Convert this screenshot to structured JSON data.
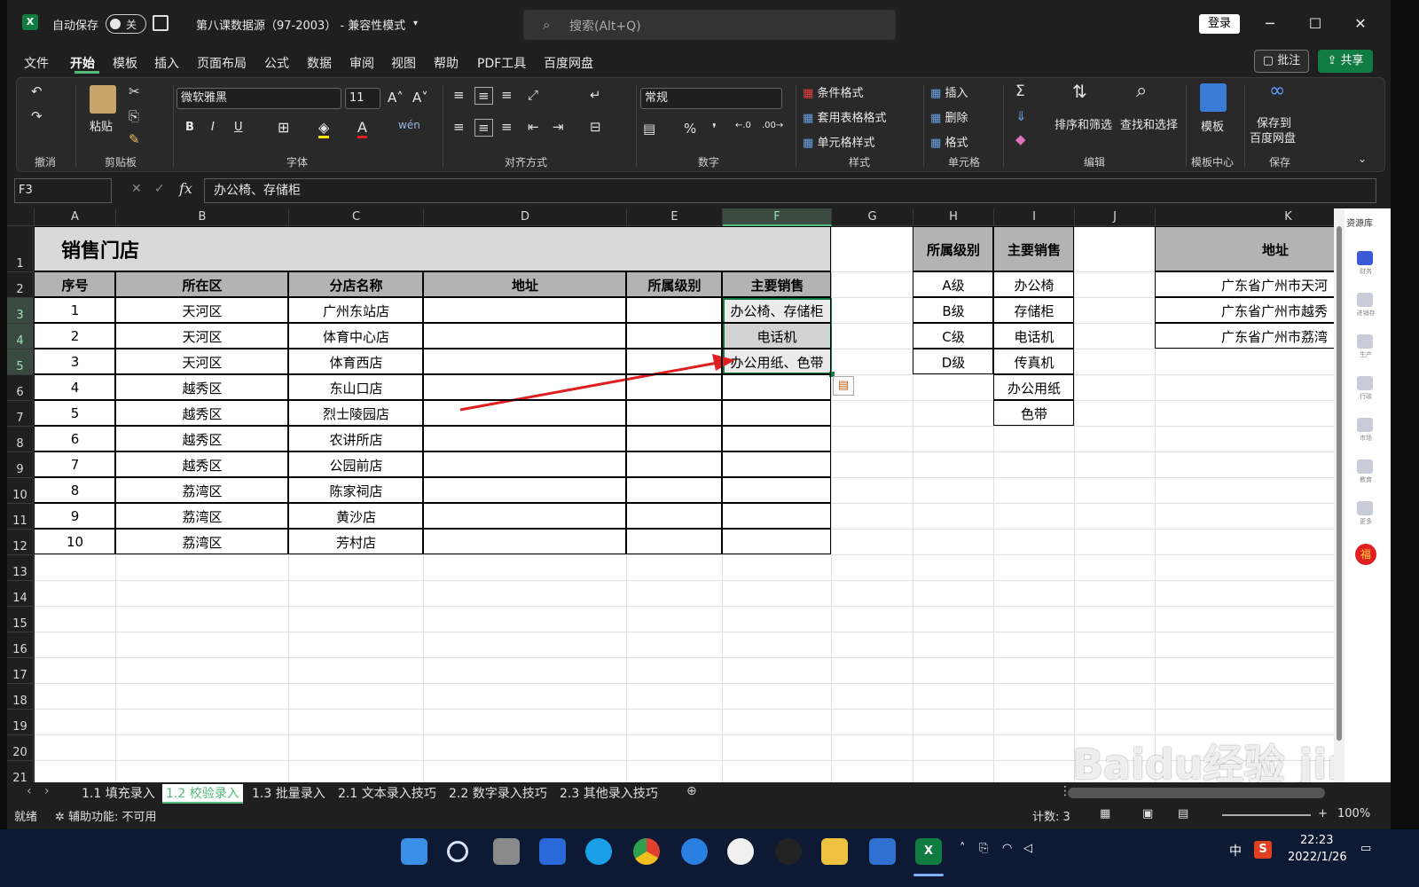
{
  "title_bar": {
    "app_icon": "X",
    "autosave_label": "自动保存",
    "autosave_state": "关",
    "document_title": "第八课数据源（97-2003） - 兼容性模式",
    "search_placeholder": "搜索(Alt+Q)",
    "login_label": "登录"
  },
  "menu": {
    "items": [
      "文件",
      "开始",
      "模板",
      "插入",
      "页面布局",
      "公式",
      "数据",
      "审阅",
      "视图",
      "帮助",
      "PDF工具",
      "百度网盘"
    ],
    "comment_label": "批注",
    "share_label": "共享"
  },
  "ribbon": {
    "groups": [
      "撤消",
      "剪贴板",
      "字体",
      "对齐方式",
      "数字",
      "样式",
      "单元格",
      "编辑",
      "模板中心",
      "保存"
    ],
    "paste_label": "粘贴",
    "font_name": "微软雅黑",
    "font_size": "11",
    "number_format": "常规",
    "style_items": [
      "条件格式",
      "套用表格格式",
      "单元格样式"
    ],
    "cell_items": [
      "插入",
      "删除",
      "格式"
    ],
    "sort_filter_label": "排序和筛选",
    "find_select_label": "查找和选择",
    "template_label": "模板",
    "save_to_label_1": "保存到",
    "save_to_label_2": "百度网盘"
  },
  "formula_bar": {
    "name_box": "F3",
    "formula": "办公椅、存储柜"
  },
  "grid": {
    "columns": [
      "A",
      "B",
      "C",
      "D",
      "E",
      "F",
      "G",
      "H",
      "I",
      "J",
      "K"
    ],
    "rows": [
      "1",
      "2",
      "3",
      "4",
      "5",
      "6",
      "7",
      "8",
      "9",
      "10",
      "11",
      "12",
      "13",
      "14",
      "15",
      "16",
      "17",
      "18",
      "19",
      "20",
      "21"
    ],
    "sheet_title": "销售门店",
    "headers": [
      "序号",
      "所在区",
      "分店名称",
      "地址",
      "所属级别",
      "主要销售"
    ],
    "data_rows": [
      [
        "1",
        "天河区",
        "广州东站店",
        "",
        "",
        "办公椅、存储柜"
      ],
      [
        "2",
        "天河区",
        "体育中心店",
        "",
        "",
        "电话机"
      ],
      [
        "3",
        "天河区",
        "体育西店",
        "",
        "",
        "办公用纸、色带"
      ],
      [
        "4",
        "越秀区",
        "东山口店",
        "",
        "",
        ""
      ],
      [
        "5",
        "越秀区",
        "烈士陵园店",
        "",
        "",
        ""
      ],
      [
        "6",
        "越秀区",
        "农讲所店",
        "",
        "",
        ""
      ],
      [
        "7",
        "越秀区",
        "公园前店",
        "",
        "",
        ""
      ],
      [
        "8",
        "荔湾区",
        "陈家祠店",
        "",
        "",
        ""
      ],
      [
        "9",
        "荔湾区",
        "黄沙店",
        "",
        "",
        ""
      ],
      [
        "10",
        "荔湾区",
        "芳村店",
        "",
        "",
        ""
      ]
    ],
    "level_header": "所属级别",
    "levels": [
      "A级",
      "B级",
      "C级",
      "D级"
    ],
    "product_header": "主要销售",
    "products": [
      "办公椅",
      "存储柜",
      "电话机",
      "传真机",
      "办公用纸",
      "色带"
    ],
    "address_header": "地址",
    "addresses": [
      "广东省广州市天河",
      "广东省广州市越秀",
      "广东省广州市荔湾"
    ]
  },
  "side_pane": {
    "title": "资源库",
    "items": [
      "财务",
      "进销存",
      "生产",
      "行政",
      "市场",
      "教育",
      "更多"
    ]
  },
  "sheet_tabs": {
    "tabs": [
      "1.1 填充录入",
      "1.2 校验录入",
      "1.3 批量录入",
      "2.1 文本录入技巧",
      "2.2 数字录入技巧",
      "2.3 其他录入技巧"
    ],
    "active_index": 1
  },
  "status_bar": {
    "ready": "就绪",
    "accessibility": "辅助功能: 不可用",
    "count": "计数: 3",
    "zoom": "100%"
  },
  "taskbar": {
    "ime": "中",
    "time": "22:23",
    "date": "2022/1/26"
  },
  "watermark": "Baidu经验 jingyan.baidu.com",
  "colors": {
    "excel_green": "#107c41",
    "header_fill": "#b3b3b3",
    "arrow": "#e02020"
  }
}
